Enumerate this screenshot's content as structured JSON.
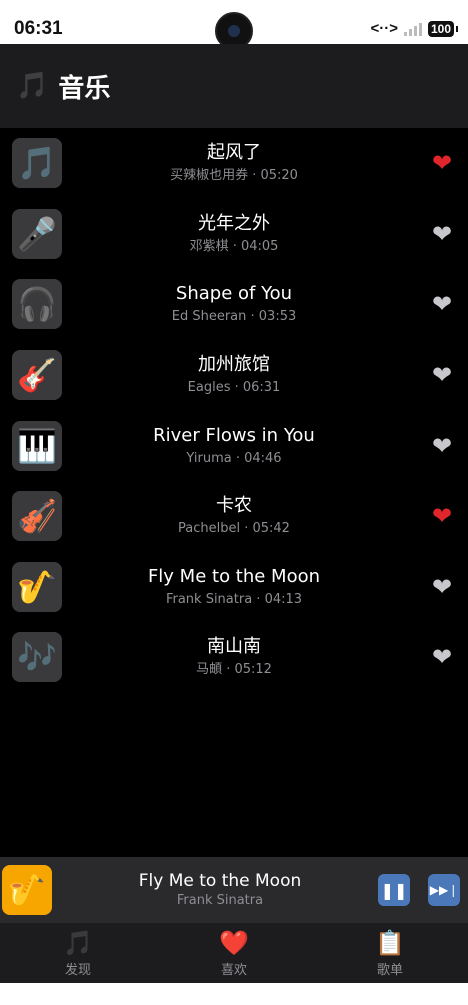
{
  "status": {
    "time": "06:31",
    "net": "<··>",
    "signal_x": "x",
    "battery": "100"
  },
  "header": {
    "icon": "music-notes-icon",
    "title": "音乐"
  },
  "songs": [
    {
      "title": "起风了",
      "subtitle": "买辣椒也用券 · 05:20",
      "cover": "🎵",
      "favorite": true
    },
    {
      "title": "光年之外",
      "subtitle": "邓紫棋 · 04:05",
      "cover": "🎤",
      "favorite": false
    },
    {
      "title": "Shape of You",
      "subtitle": "Ed Sheeran · 03:53",
      "cover": "🎧",
      "favorite": false
    },
    {
      "title": "加州旅馆",
      "subtitle": "Eagles · 06:31",
      "cover": "🎸",
      "favorite": false
    },
    {
      "title": "River Flows in You",
      "subtitle": "Yiruma · 04:46",
      "cover": "🎹",
      "favorite": false
    },
    {
      "title": "卡农",
      "subtitle": "Pachelbel · 05:42",
      "cover": "🎻",
      "favorite": true
    },
    {
      "title": "Fly Me to the Moon",
      "subtitle": "Frank Sinatra · 04:13",
      "cover": "🎷",
      "favorite": false
    },
    {
      "title": "南山南",
      "subtitle": "马頔 · 05:12",
      "cover": "🎶",
      "favorite": false
    }
  ],
  "player": {
    "title": "Fly Me to the Moon",
    "artist": "Frank Sinatra",
    "cover": "🎷",
    "pause": "❚❚",
    "next": "▶▶❘"
  },
  "tabs": [
    {
      "label": "发现",
      "icon": "🎵"
    },
    {
      "label": "喜欢",
      "icon": "❤️"
    },
    {
      "label": "歌单",
      "icon": "📋"
    }
  ],
  "colors": {
    "favorite_on": "#e0262a",
    "favorite_off": "#c7c7cc",
    "accent_button": "#4a78b8",
    "player_cover_bg": "#f7a600"
  }
}
